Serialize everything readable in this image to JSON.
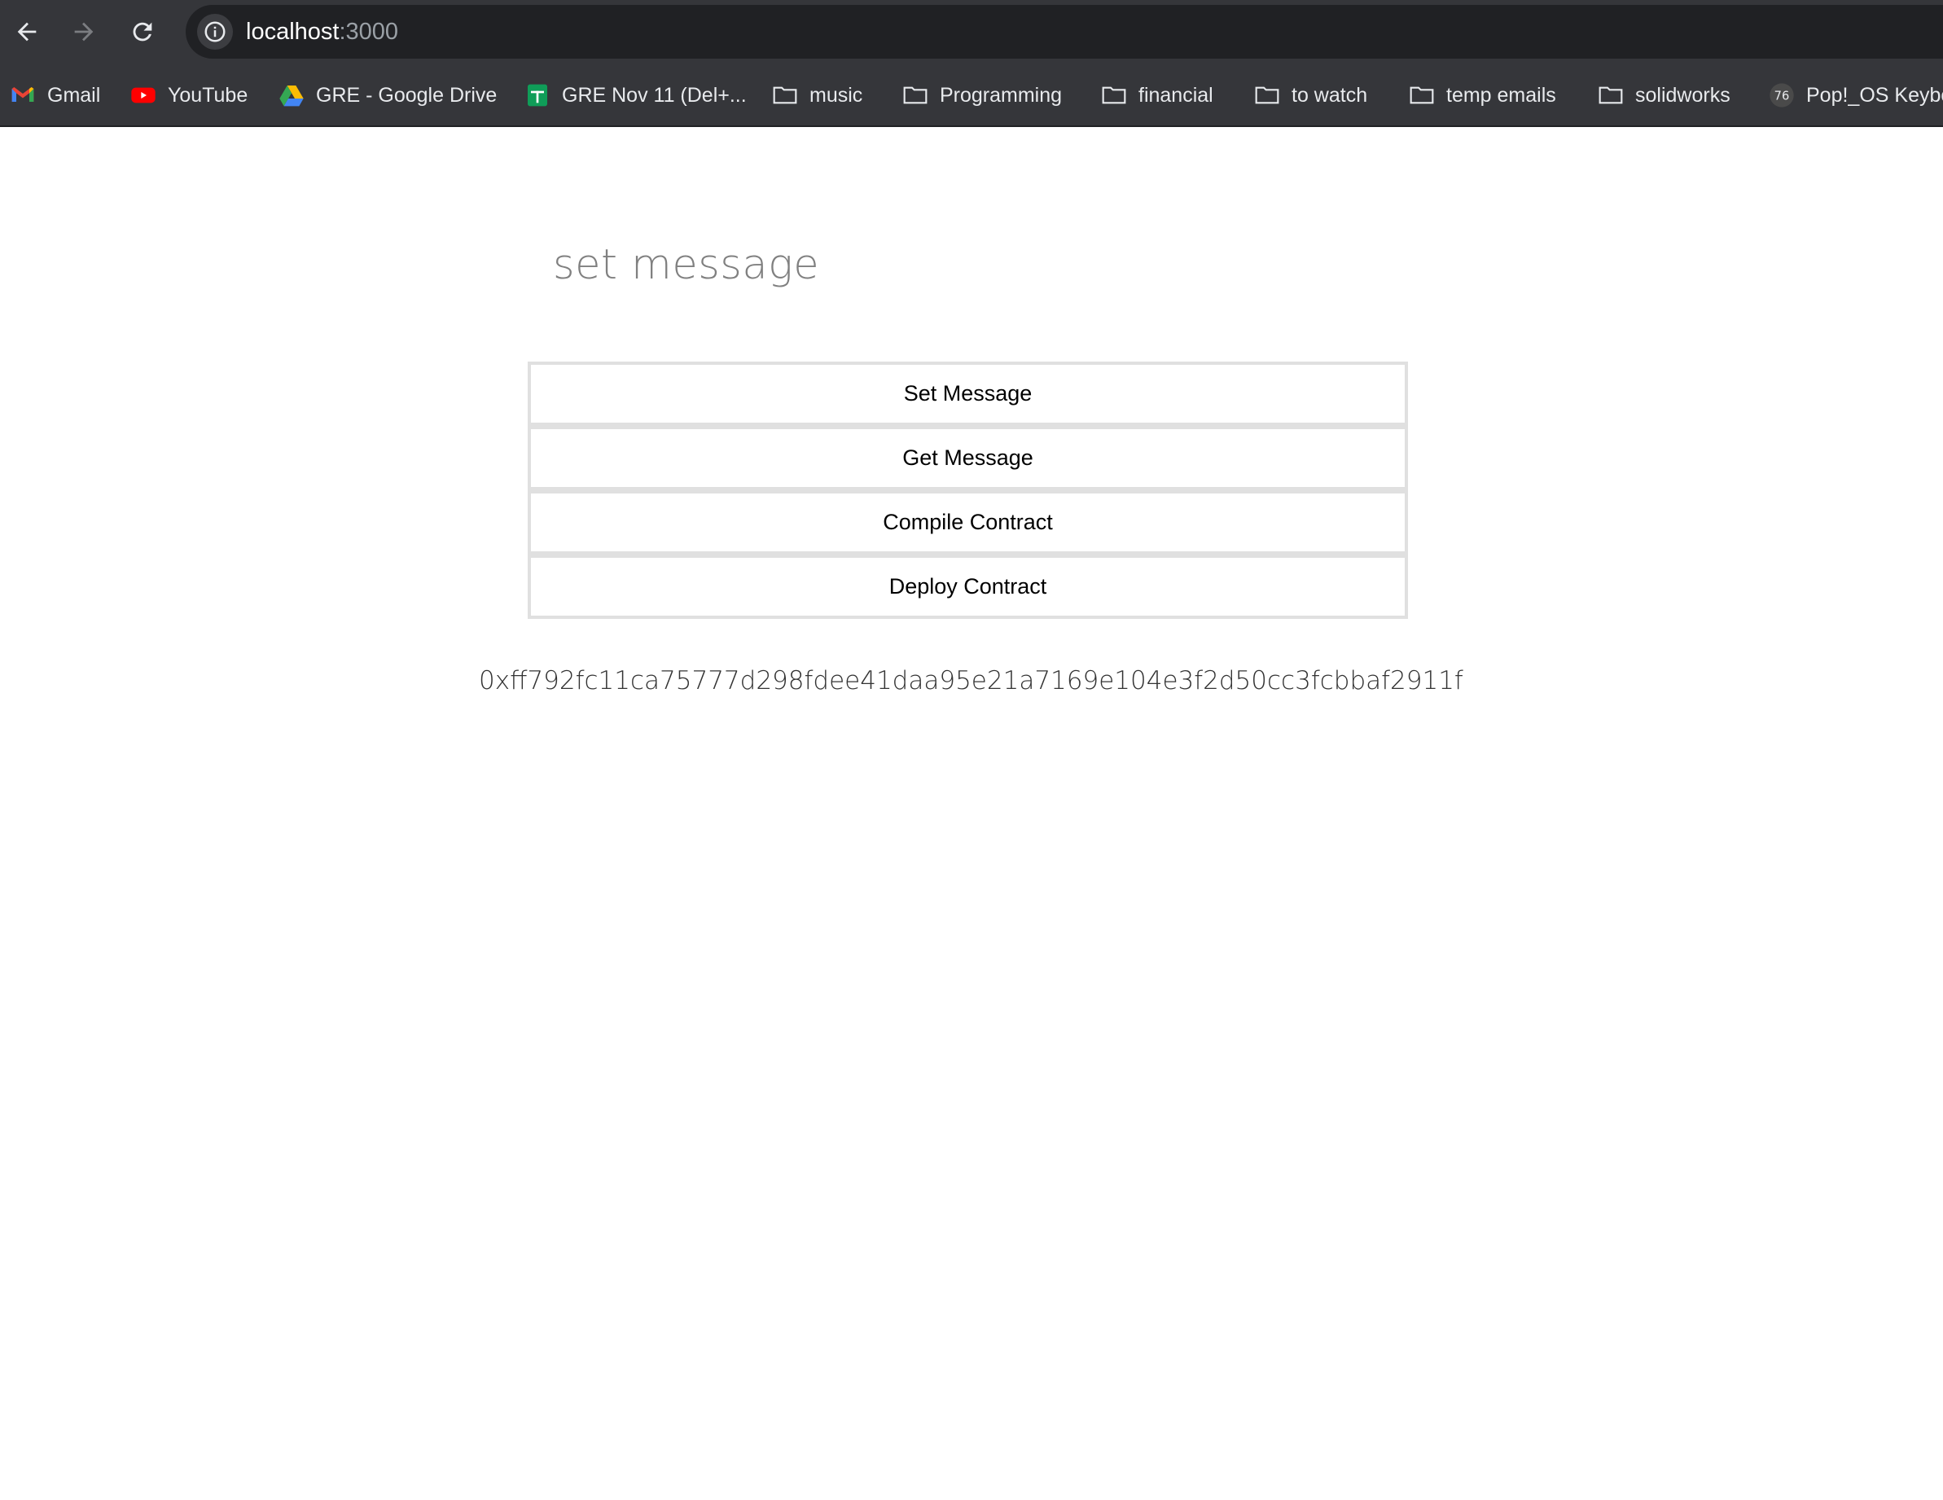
{
  "browser": {
    "url_host": "localhost",
    "url_port": ":3000",
    "bookmarks": [
      {
        "label": "Gmail",
        "icon": "gmail-icon"
      },
      {
        "label": "YouTube",
        "icon": "youtube-icon"
      },
      {
        "label": "GRE - Google Drive",
        "icon": "google-drive-icon"
      },
      {
        "label": "GRE Nov 11 (Del+...",
        "icon": "google-sheets-icon"
      },
      {
        "label": "music",
        "icon": "folder-icon"
      },
      {
        "label": "Programming",
        "icon": "folder-icon"
      },
      {
        "label": "financial",
        "icon": "folder-icon"
      },
      {
        "label": "to watch",
        "icon": "folder-icon"
      },
      {
        "label": "temp emails",
        "icon": "folder-icon"
      },
      {
        "label": "solidworks",
        "icon": "folder-icon"
      },
      {
        "label": "Pop!_OS Keybo",
        "icon": "popos-icon"
      }
    ]
  },
  "main": {
    "input_placeholder": "set message",
    "buttons": {
      "set": "Set Message",
      "get": "Get Message",
      "compile": "Compile Contract",
      "deploy": "Deploy Contract"
    },
    "address": "0xff792fc11ca75777d298fdee41daa95e21a7169e104e3f2d50cc3fcbbaf2911f"
  },
  "colors": {
    "chrome_bg": "#35363a",
    "omnibox_bg": "#202124",
    "button_border": "#e0e0e0"
  }
}
